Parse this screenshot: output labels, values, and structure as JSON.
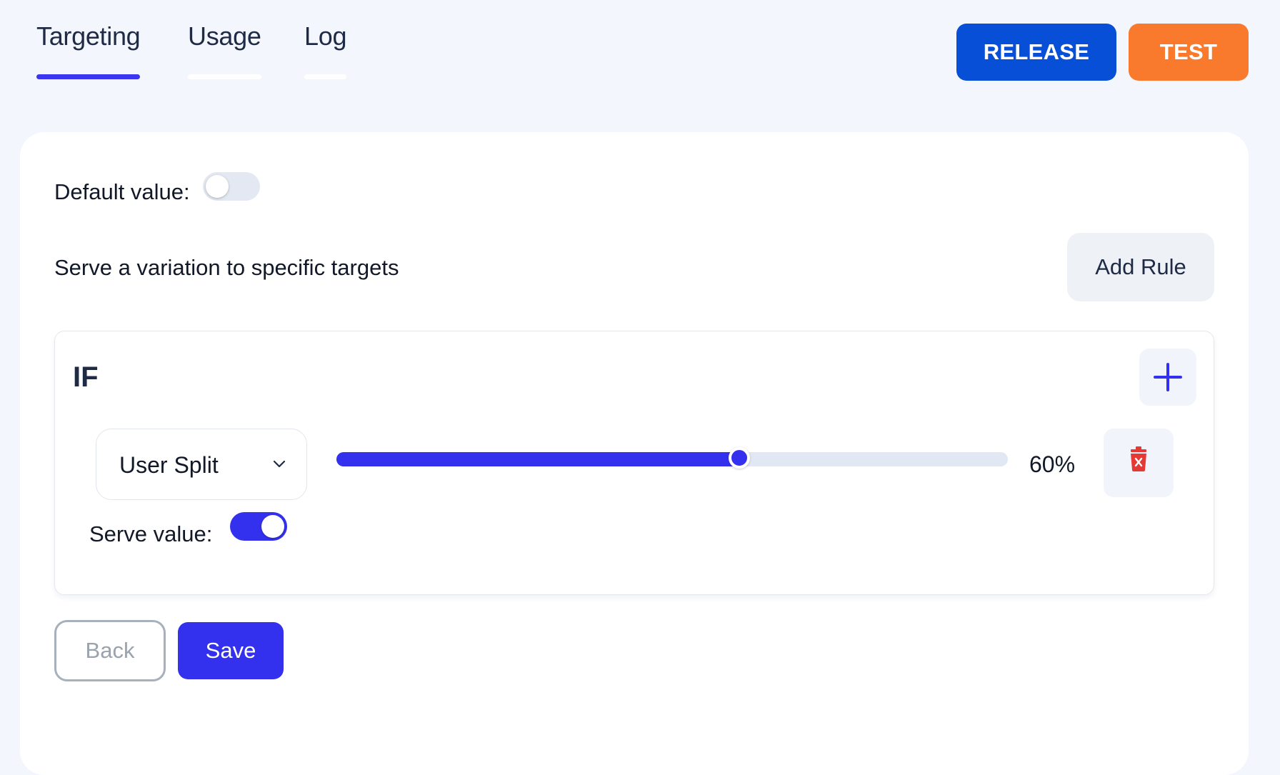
{
  "tabs": [
    {
      "label": "Targeting",
      "active": true
    },
    {
      "label": "Usage",
      "active": false
    },
    {
      "label": "Log",
      "active": false
    }
  ],
  "header_actions": {
    "release_label": "RELEASE",
    "test_label": "TEST"
  },
  "default_value": {
    "label": "Default value:",
    "enabled": false
  },
  "targets": {
    "label": "Serve a variation to specific targets",
    "add_rule_label": "Add Rule"
  },
  "rule": {
    "if_label": "IF",
    "condition_select": {
      "selected": "User Split"
    },
    "split_percent": 60,
    "split_percent_label": "60%",
    "serve_value": {
      "label": "Serve value:",
      "enabled": true
    }
  },
  "footer": {
    "back_label": "Back",
    "save_label": "Save"
  },
  "colors": {
    "accent": "#3431ee",
    "release": "#064fd6",
    "test": "#f97a2c",
    "delete_icon": "#e53935"
  },
  "icons": {
    "add_condition": "plus-icon",
    "select_arrow": "chevron-down-icon",
    "delete_condition": "trash-icon"
  }
}
